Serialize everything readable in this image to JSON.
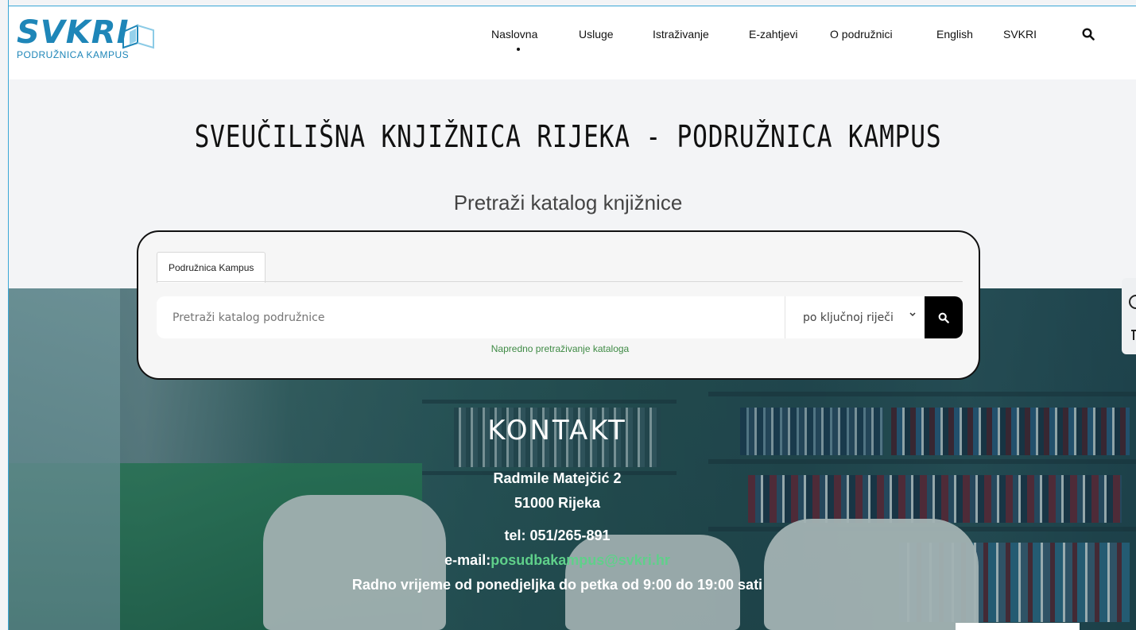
{
  "header": {
    "logo_word": "SVKRI",
    "logo_sub": "PODRUŽNICA KAMPUS",
    "nav": [
      {
        "label": "Naslovna",
        "active": true
      },
      {
        "label": "Usluge"
      },
      {
        "label": "Istraživanje"
      },
      {
        "label": "E-zahtjevi"
      },
      {
        "label": "O podružnici"
      },
      {
        "label": "English"
      },
      {
        "label": "SVKRI"
      }
    ],
    "search_icon": "search-icon"
  },
  "main": {
    "title": "SVEUČILIŠNA KNJIŽNICA RIJEKA - PODRUŽNICA KAMPUS",
    "subtitle": "Pretraži katalog knjižnice"
  },
  "search": {
    "tab_label": "Podružnica Kampus",
    "placeholder": "Pretraži katalog podružnice",
    "select_value": "po ključnoj riječi",
    "advanced_link": "Napredno pretraživanje kataloga"
  },
  "contact": {
    "title": "KONTAKT",
    "address1": "Radmile Matejčić 2",
    "address2": "51000 Rijeka",
    "phone": "tel: 051/265-891",
    "email_label": "e-mail:",
    "email": "posudbakampus@svkri.hr",
    "hours": "Radno vrijeme od ponedjeljka do petka od 9:00 do 19:00 sati"
  },
  "colors": {
    "accent": "#1e86b8",
    "link_green": "#3e8a44",
    "email_green": "#5fd08a"
  }
}
